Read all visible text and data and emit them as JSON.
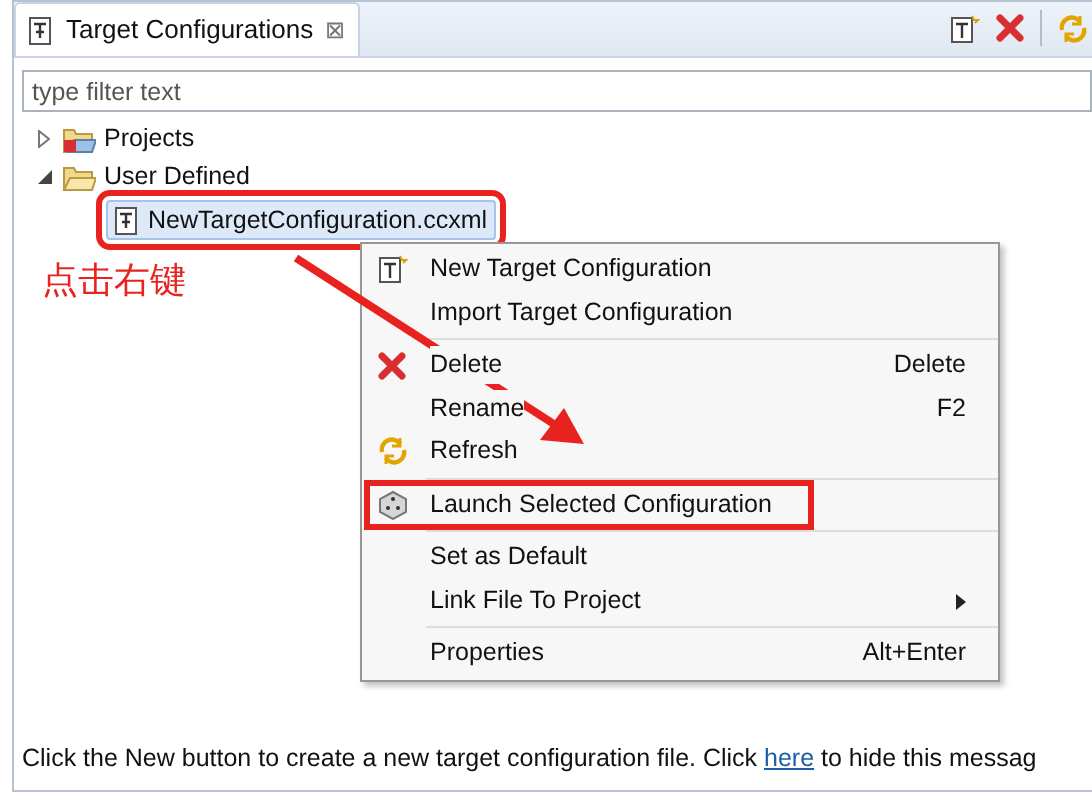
{
  "view_tab": {
    "title": "Target Configurations",
    "close": "⊠"
  },
  "filter": {
    "placeholder": "type filter text"
  },
  "tree": [
    {
      "label": "Projects",
      "expanded": false,
      "kind": "projects"
    },
    {
      "label": "User Defined",
      "expanded": true,
      "kind": "folder",
      "children": [
        {
          "label": "NewTargetConfiguration.ccxml",
          "selected": true,
          "annotated": true,
          "kind": "file"
        }
      ]
    }
  ],
  "annotation": {
    "text": "点击右键"
  },
  "context_menu": [
    [
      {
        "label": "New Target Configuration",
        "kind": "new",
        "submenu": false,
        "annotated": false
      },
      {
        "label": "Import Target Configuration",
        "kind": "plain",
        "submenu": false,
        "annotated": false
      }
    ],
    [
      {
        "label": "Delete",
        "shortcut": "Delete",
        "kind": "delete",
        "submenu": false,
        "annotated": false
      },
      {
        "label": "Rename",
        "shortcut": "F2",
        "kind": "plain",
        "submenu": false,
        "annotated": false
      },
      {
        "label": "Refresh",
        "kind": "refresh",
        "submenu": false,
        "annotated": false
      }
    ],
    [
      {
        "label": "Launch Selected Configuration",
        "kind": "launch",
        "submenu": false,
        "annotated": true
      }
    ],
    [
      {
        "label": "Set as Default",
        "kind": "plain",
        "submenu": false,
        "annotated": false
      },
      {
        "label": "Link File To Project",
        "kind": "plain",
        "submenu": true,
        "annotated": false
      }
    ],
    [
      {
        "label": "Properties",
        "shortcut": "Alt+Enter",
        "kind": "plain",
        "submenu": false,
        "annotated": false
      }
    ]
  ],
  "message": {
    "before": "Click the New button to create a new target configuration file. Click ",
    "link": "here",
    "after": " to hide this messag"
  }
}
